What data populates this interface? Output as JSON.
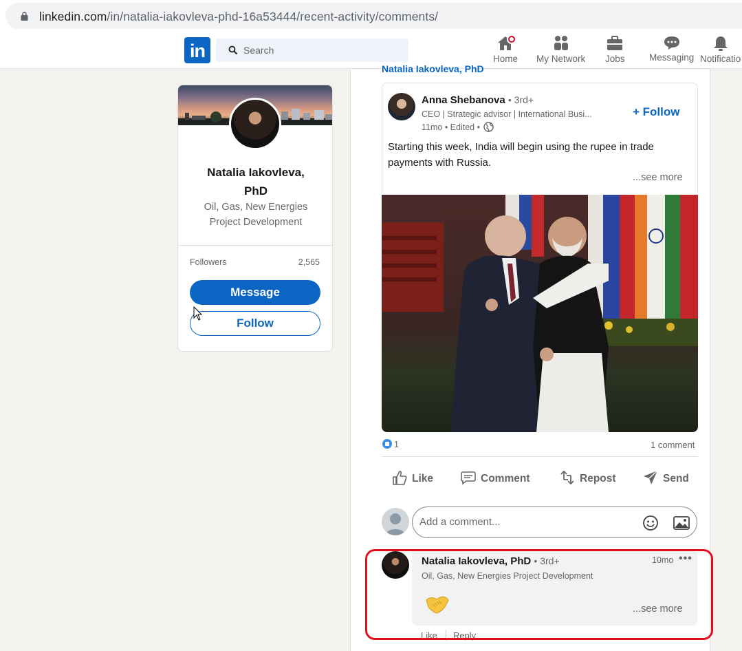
{
  "browser": {
    "url_host": "linkedin.com",
    "url_path": "/in/natalia-iakovleva-phd-16a53444/recent-activity/comments/"
  },
  "nav": {
    "logo": "in",
    "search_placeholder": "Search",
    "items": [
      {
        "label": "Home",
        "icon": "home-icon",
        "has_badge": true
      },
      {
        "label": "My Network",
        "icon": "network-icon"
      },
      {
        "label": "Jobs",
        "icon": "briefcase-icon"
      },
      {
        "label": "Messaging",
        "icon": "messaging-icon"
      },
      {
        "label": "Notificatio",
        "icon": "bell-icon"
      }
    ]
  },
  "profile": {
    "name_line1": "Natalia Iakovleva,",
    "name_line2": "PhD",
    "headline_line1": "Oil, Gas, New Energies",
    "headline_line2": "Project Development",
    "followers_label": "Followers",
    "followers_count": "2,565",
    "message_button": "Message",
    "follow_button": "Follow"
  },
  "feed": {
    "top_actor": "Natalia Iakovleva, PhD",
    "post": {
      "author": "Anna Shebanova",
      "degree": "• 3rd+",
      "headline": "CEO | Strategic advisor | International Busi...",
      "meta": "11mo • Edited •",
      "follow_label": "+ Follow",
      "text": "Starting this week, India will begin using the rupee in trade payments with Russia.",
      "see_more": "...see more",
      "reaction_count": "1",
      "comment_count": "1 comment",
      "actions": [
        {
          "label": "Like",
          "icon": "thumbs-up-icon"
        },
        {
          "label": "Comment",
          "icon": "comment-icon"
        },
        {
          "label": "Repost",
          "icon": "repost-icon"
        },
        {
          "label": "Send",
          "icon": "send-icon"
        }
      ],
      "comment_placeholder": "Add a comment..."
    },
    "comment": {
      "author": "Natalia Iakovleva, PhD",
      "degree": "• 3rd+",
      "headline": "Oil, Gas, New Energies Project Development",
      "time": "10mo",
      "more": "•••",
      "see_more": "...see more",
      "like": "Like",
      "reply": "Reply"
    }
  },
  "colors": {
    "brand": "#0a66c2",
    "highlight": "#e0101e"
  }
}
